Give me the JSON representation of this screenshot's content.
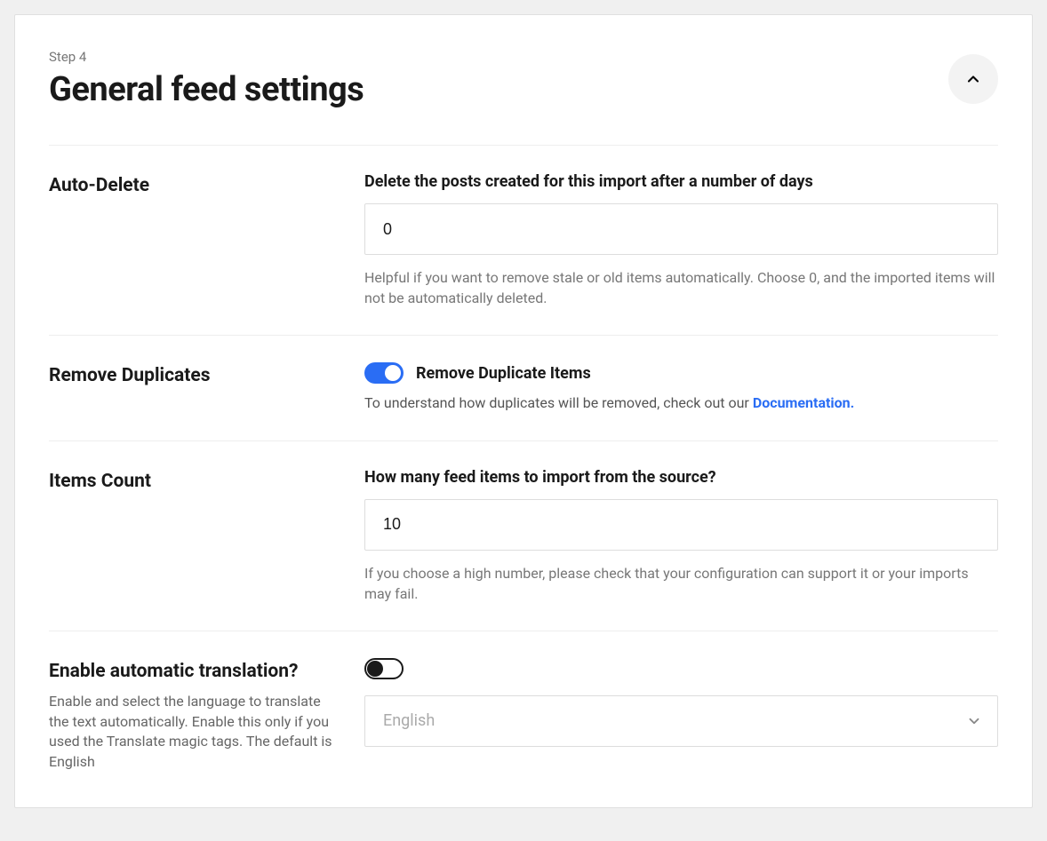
{
  "header": {
    "step_label": "Step 4",
    "title": "General feed settings"
  },
  "auto_delete": {
    "row_label": "Auto-Delete",
    "field_title": "Delete the posts created for this import after a number of days",
    "value": "0",
    "helper": "Helpful if you want to remove stale or old items automatically. Choose 0, and the imported items will not be automatically deleted."
  },
  "remove_duplicates": {
    "row_label": "Remove Duplicates",
    "toggle_label": "Remove Duplicate Items",
    "toggle_on": true,
    "desc_prefix": "To understand how duplicates will be removed, check out our ",
    "link_text": "Documentation."
  },
  "items_count": {
    "row_label": "Items Count",
    "field_title": "How many feed items to import from the source?",
    "value": "10",
    "helper": "If you choose a high number, please check that your configuration can support it or your imports may fail."
  },
  "translation": {
    "row_label": "Enable automatic translation?",
    "row_subtext": "Enable and select the language to translate the text automatically. Enable this only if you used the Translate magic tags. The default is English",
    "toggle_on": false,
    "select_value": "English"
  }
}
